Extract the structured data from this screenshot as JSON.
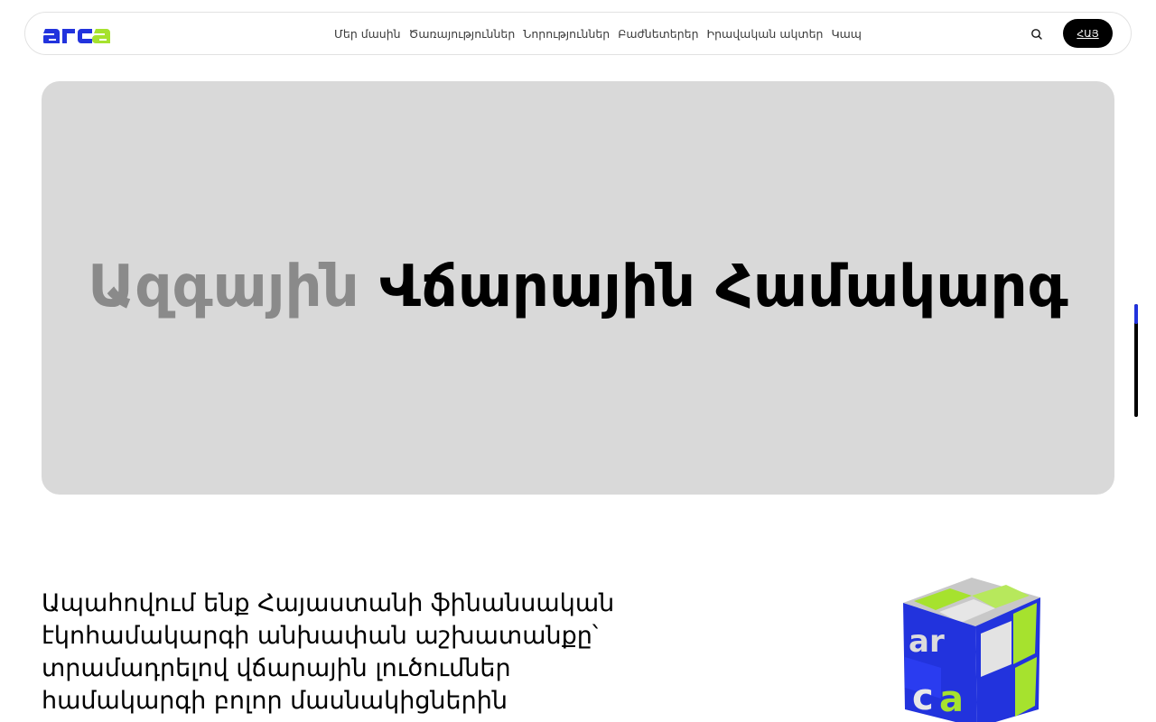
{
  "header": {
    "logo_text": "arca",
    "nav": [
      {
        "label": "Մեր մասին"
      },
      {
        "label": "Ծառայություններ"
      },
      {
        "label": "Նորություններ"
      },
      {
        "label": "Բաժնետերեր"
      },
      {
        "label": "Իրավական ակտեր"
      },
      {
        "label": "Կապ"
      }
    ],
    "search_icon": "search-icon",
    "lang_label": "ՀԱՅ"
  },
  "hero": {
    "title_first": "Ազգային",
    "title_rest": " Վճարային Համակարգ"
  },
  "mission": {
    "text": "Ապահովում ենք Հայաստանի ֆինանսական\nէկոհամակարգի անխափան աշխատանքը՝\nտրամադրելով վճարային լուծումներ\nհամակարգի բոլոր մասնակիցներին"
  },
  "colors": {
    "brand_blue": "#2233dd",
    "brand_green": "#a6e22e",
    "hero_bg": "#d9d9d9",
    "button_bg": "#000000"
  }
}
